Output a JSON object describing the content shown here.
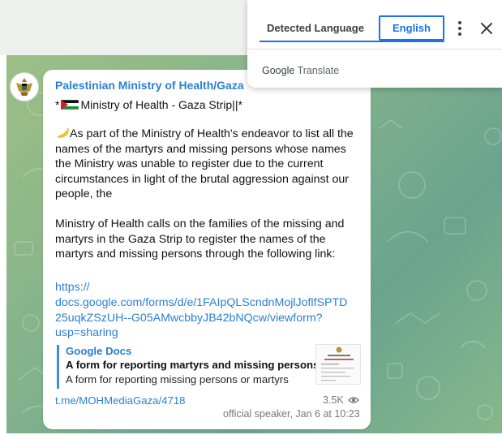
{
  "translate_popup": {
    "tab_detected": "Detected Language",
    "tab_target": "English",
    "brand_google": "Google",
    "brand_translate": "Translate",
    "accent": "#1a73e8"
  },
  "message": {
    "sender": "Palestinian Ministry of Health/Gaza",
    "subline_prefix": "*",
    "subline_text": "Ministry of Health - Gaza Strip||*",
    "para1": [
      "As part of the Ministry of Health's endeavor to list all the",
      "names of the martyrs and missing persons whose names",
      "the Ministry was unable to register due to the current",
      "circumstances in light of the brutal aggression against our",
      "people, the"
    ],
    "para2": [
      "Ministry of Health calls on the families of the missing and",
      "martyrs in the Gaza Strip to register the names of the",
      "martyrs and missing persons through the following link:"
    ],
    "link_lines": [
      "https://",
      "docs.google.com/forms/d/e/1FAIpQLScndnMojlJoflfSPTD",
      "25uqkZSzUH--G05AMwcbbyJB42bNQcw/viewform?",
      "usp=sharing"
    ],
    "preview": {
      "site": "Google Docs",
      "title": "A form for reporting martyrs and missing persons",
      "description": "A form for reporting missing persons or martyrs"
    },
    "post_link": "t.me/MOHMediaGaza/4718",
    "views": "3.5K",
    "footer": "official speaker, Jan 6 at 10:23",
    "link_color": "#2a7fd4"
  },
  "icons": {
    "emoji": "crescent-moon-emoji-icon",
    "flag": "palestine-flag-icon",
    "views": "eye-icon",
    "more": "more-vertical-icon",
    "close": "close-icon",
    "avatar": "ministry-emblem-avatar"
  }
}
